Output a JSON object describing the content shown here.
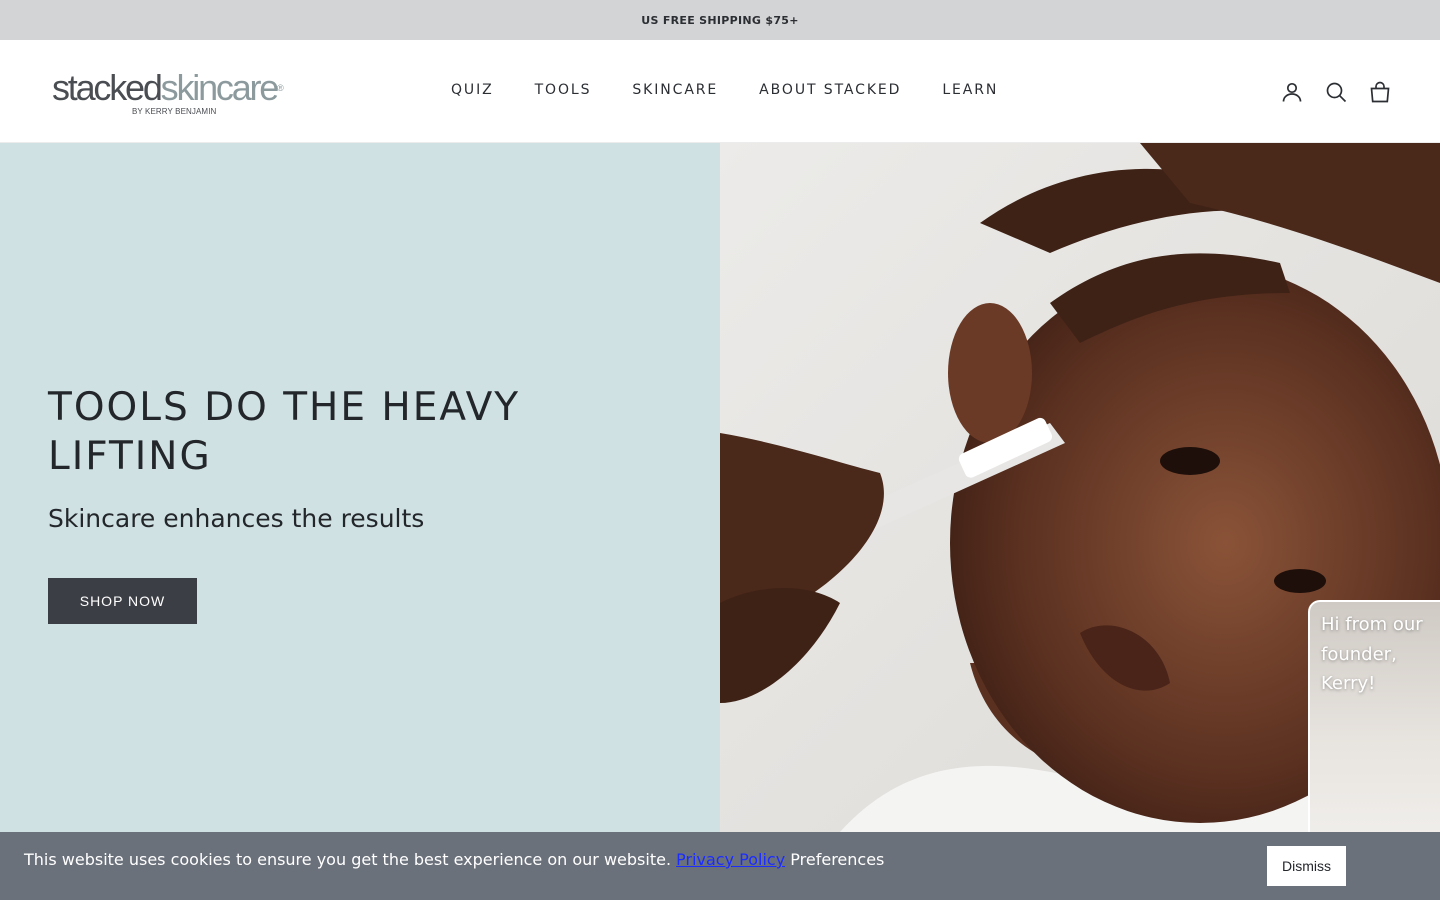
{
  "announcement": {
    "text": "US FREE SHIPPING $75+"
  },
  "logo": {
    "primary": "stacked",
    "secondary": "skincare",
    "mark": "®",
    "byline": "BY KERRY BENJAMIN"
  },
  "nav": {
    "items": [
      {
        "label": "QUIZ"
      },
      {
        "label": "TOOLS"
      },
      {
        "label": "SKINCARE"
      },
      {
        "label": "ABOUT STACKED"
      },
      {
        "label": "LEARN"
      }
    ]
  },
  "header_icons": [
    "account-icon",
    "search-icon",
    "bag-icon"
  ],
  "hero": {
    "title": "TOOLS DO THE HEAVY LIFTING",
    "subtitle": "Skincare enhances the results",
    "cta": "SHOP NOW",
    "left_bg": "#cfe1e3"
  },
  "founder_widget": {
    "text": "Hi from our founder, Kerry!"
  },
  "cookie_banner": {
    "message": "This website uses cookies to ensure you get the best experience on our website.",
    "privacy_link": "Privacy Policy",
    "preferences": "Preferences",
    "dismiss": "Dismiss"
  },
  "colors": {
    "announce_bg": "#d3d4d5",
    "button_dark": "#3b3e45",
    "cookie_bg": "#6b717b",
    "link": "#1b2cff"
  }
}
